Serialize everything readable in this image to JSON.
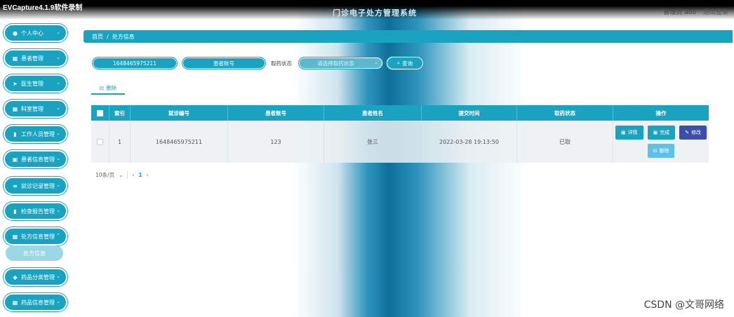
{
  "window": {
    "recorder_label": "EVCapture4.1.9软件录制",
    "system_title": "门诊电子处方管理系统",
    "user_label": "管理员 abo",
    "exit_label": "退出登录"
  },
  "sidebar": {
    "items": [
      {
        "label": "个人中心",
        "icon": "user-icon"
      },
      {
        "label": "患者管理",
        "icon": "grid-icon"
      },
      {
        "label": "医生管理",
        "icon": "send-icon"
      },
      {
        "label": "科室管理",
        "icon": "grid-icon"
      },
      {
        "label": "工作人员管理",
        "icon": "book-icon"
      },
      {
        "label": "患者信息管理",
        "icon": "file-icon"
      },
      {
        "label": "就诊记录管理",
        "icon": "list-icon"
      },
      {
        "label": "检查报告管理",
        "icon": "chart-icon"
      },
      {
        "label": "处方信息管理",
        "icon": "grid-icon"
      },
      {
        "label": "药品分类管理",
        "icon": "thumb-icon"
      },
      {
        "label": "药品信息管理",
        "icon": "grid-icon"
      }
    ],
    "active_sub_item": "处方信息"
  },
  "breadcrumb": {
    "home": "首页",
    "separator": "/",
    "current": "处方信息"
  },
  "search": {
    "prescription_no_value": "1648465975211",
    "patient_account_placeholder": "患者账号",
    "fetch_status_label": "取药状态",
    "fetch_status_placeholder": "请选择取药状态",
    "query_label": "查询"
  },
  "actions": {
    "delete_label": "删除"
  },
  "table": {
    "headers": [
      "索引",
      "就诊编号",
      "患者账号",
      "患者姓名",
      "提交时间",
      "取药状态",
      "操作"
    ],
    "rows": [
      {
        "index": "1",
        "visit_no": "1648465975211",
        "patient_account": "123",
        "patient_name": "张三",
        "submit_time": "2022-03-28 19:13:50",
        "fetch_status": "已取",
        "ops": {
          "detail": "详情",
          "done": "完成",
          "edit": "修改",
          "delete": "删除"
        }
      }
    ]
  },
  "pagination": {
    "page_size": "10条/页",
    "current_page": "1",
    "prev": "‹",
    "next": "›"
  },
  "watermark": "CSDN @文哥网络",
  "colors": {
    "accent": "#1aa3c1",
    "edit_button": "#3c4fa8",
    "delete_button": "#5ec2e8"
  }
}
